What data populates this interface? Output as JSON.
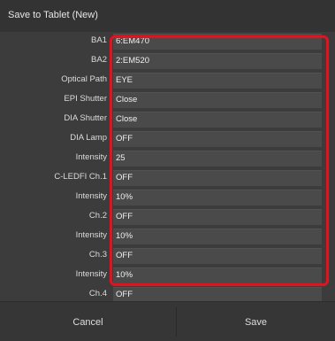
{
  "dialog": {
    "title": "Save to Tablet (New)"
  },
  "settings": [
    {
      "label": "BA1",
      "value": "6:EM470"
    },
    {
      "label": "BA2",
      "value": "2:EM520"
    },
    {
      "label": "Optical Path",
      "value": "EYE"
    },
    {
      "label": "EPI Shutter",
      "value": "Close"
    },
    {
      "label": "DIA Shutter",
      "value": "Close"
    },
    {
      "label": "DIA Lamp",
      "value": "OFF"
    },
    {
      "label": "Intensity",
      "value": "25"
    },
    {
      "label": "C-LEDFI Ch.1",
      "value": "OFF"
    },
    {
      "label": "Intensity",
      "value": "10%"
    },
    {
      "label": "Ch.2",
      "value": "OFF"
    },
    {
      "label": "Intensity",
      "value": "10%"
    },
    {
      "label": "Ch.3",
      "value": "OFF"
    },
    {
      "label": "Intensity",
      "value": "10%"
    },
    {
      "label": "Ch.4",
      "value": "OFF"
    }
  ],
  "buttons": {
    "cancel": "Cancel",
    "save": "Save"
  },
  "colors": {
    "highlight": "#e8101a",
    "background": "#3a3a3a"
  }
}
